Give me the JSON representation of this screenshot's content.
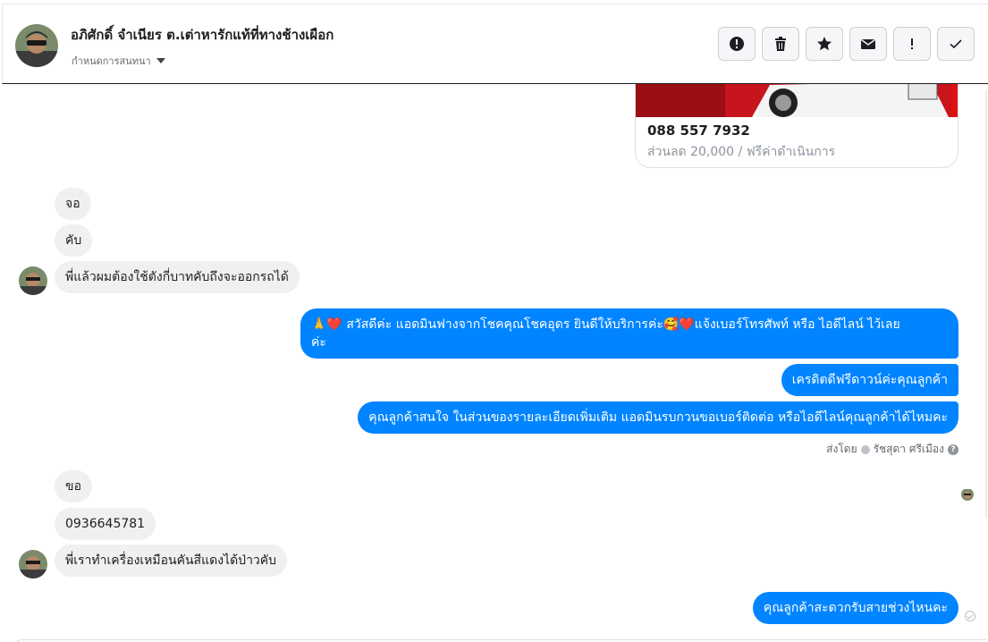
{
  "header": {
    "name": "อภิศักดิ์ จำเนียร ต.เต่าหารักแท้ที่ทางช้างเผือก",
    "assign_label": "กำหนดการสนทนา",
    "actions": [
      {
        "icon": "alert-circle-icon",
        "label": "mark-spam"
      },
      {
        "icon": "trash-icon",
        "label": "delete"
      },
      {
        "icon": "star-icon",
        "label": "star"
      },
      {
        "icon": "envelope-icon",
        "label": "mark-unread"
      },
      {
        "icon": "exclamation-icon",
        "label": "follow-up"
      },
      {
        "icon": "check-icon",
        "label": "done"
      }
    ]
  },
  "card": {
    "phone": "088 557 7932",
    "desc": "ส่วนลด 20,000 / ฟรีค่าดำเนินการ"
  },
  "messages": {
    "m1": "จอ",
    "m2": "คับ",
    "m3": "พี่แล้วผมต้องใช้ตังกี่บาทคับถึงจะออกรถได้",
    "m4_line1": "🙏❤️ สวัสดีค่ะ แอดมินฟางจากโชคคุณโชคอุดร ยินดีให้บริการค่ะ🥰❤️แจ้งเบอร์โทรศัพท์ หรือ ไอดีไลน์  ไว้เลย",
    "m4_line2": "ค่ะ",
    "m5": "เครดิตดีฟรีดาวน์ค่ะคุณลูกค้า",
    "m6": "คุณลูกค้าสนใจ ในส่วนของรายละเอียดเพิ่มเติม แอดมินรบกวนขอเบอร์ติดต่อ หรือไอดีไลน์คุณลูกค้าได้ไหมคะ",
    "sent_by_prefix": "ส่งโดย",
    "sent_by_name": "รัชสุดา ศรีเมือง",
    "m7": "ขอ",
    "m8": "0936645781",
    "m9": "พี่เราทำเครื่องเหมือนคันสีแดงได้ป่าวคับ",
    "m10": "คุณลูกค้าสะดวกรับสายช่วงไหนคะ"
  },
  "colors": {
    "outgoing": "#0084ff",
    "incoming": "#f0f0f0"
  }
}
